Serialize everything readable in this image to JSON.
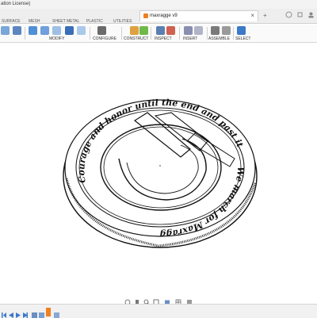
{
  "window": {
    "license_text": "ation License)"
  },
  "document_tab": {
    "title": "maxragge v9"
  },
  "workspace_tabs": [
    "SURFACE",
    "MESH",
    "SHEET METAL",
    "PLASTIC",
    "UTILITIES"
  ],
  "toolbar": {
    "groups": [
      "MODIFY",
      "CONFIGURE",
      "CONSTRUCT",
      "INSPECT",
      "INSERT",
      "ASSEMBLE",
      "SELECT"
    ]
  },
  "coin": {
    "inscription_top": "Courage and honor until the end and past it",
    "inscription_bottom": "We march for Maxragge"
  },
  "icons": {
    "close": "close-icon",
    "add_tab": "plus-icon",
    "orbit": "orbit-icon",
    "pan": "pan-icon",
    "zoom": "zoom-icon",
    "fit": "fit-icon",
    "display": "display-settings-icon",
    "grid": "grid-icon",
    "viewports": "viewports-icon",
    "play": "play-icon",
    "marker": "timeline-marker-icon"
  },
  "colors": {
    "accent": "#f08020",
    "toolbar_bg": "#fafafa",
    "canvas_bg": "#ffffff",
    "line": "#111111"
  }
}
